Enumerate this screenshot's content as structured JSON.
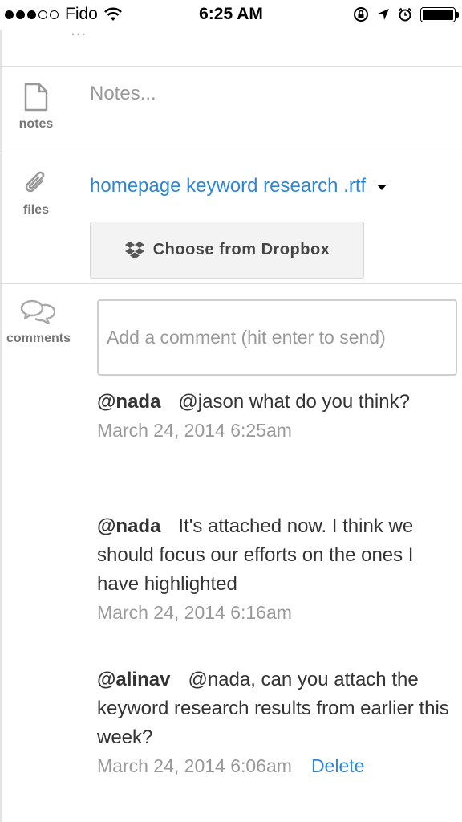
{
  "status_bar": {
    "carrier": "Fido",
    "time": "6:25 AM",
    "signal_bars_filled": 3,
    "signal_bars_total": 5,
    "battery_level": 1.0
  },
  "partial_header_text": "...",
  "notes": {
    "label": "notes",
    "placeholder": "Notes..."
  },
  "files": {
    "label": "files",
    "file_name": "homepage keyword research .rtf",
    "dropbox_button": "Choose from Dropbox"
  },
  "comments": {
    "label": "comments",
    "input_placeholder": "Add a comment (hit enter to send)",
    "items": [
      {
        "author": "@nada",
        "text": "@jason what do you think?",
        "timestamp": "March 24, 2014 6:25am"
      },
      {
        "author": "@nada",
        "text": "It's attached now. I think we should focus our efforts on the ones I have highlighted",
        "timestamp": "March 24, 2014 6:16am"
      },
      {
        "author": "@alinav",
        "text": "@nada, can you attach the keyword research results from earlier this week?",
        "timestamp": "March 24, 2014 6:06am",
        "delete_label": "Delete"
      }
    ]
  },
  "colors": {
    "link": "#2f86d5",
    "muted": "#999999",
    "divider": "#dcdcdc"
  }
}
